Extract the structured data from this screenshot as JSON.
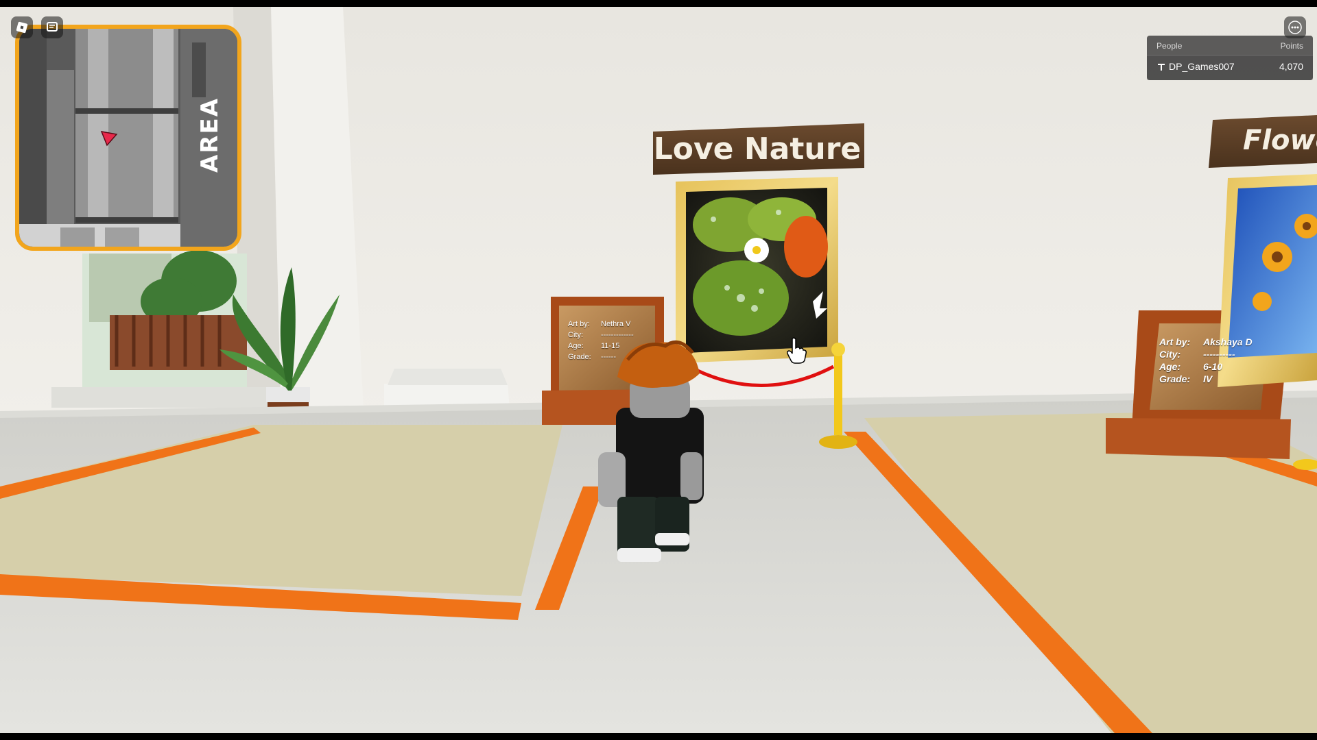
{
  "signs": {
    "left_title": "Love Nature",
    "right_title": "Flowe"
  },
  "plaque_left": {
    "art_by_label": "Art by:",
    "art_by_value": "Nethra V",
    "city_label": "City:",
    "city_value": "-------------",
    "age_label": "Age:",
    "age_value": "11-15",
    "grade_label": "Grade:",
    "grade_value": "------"
  },
  "plaque_right": {
    "art_by_label": "Art by:",
    "art_by_value": "Akshaya D",
    "city_label": "City:",
    "city_value": "----------",
    "age_label": "Age:",
    "age_value": "6-10",
    "grade_label": "Grade:",
    "grade_value": "IV"
  },
  "minimap": {
    "area_label": "AREA"
  },
  "leaderboard": {
    "header_people": "People",
    "header_points": "Points",
    "rows": [
      {
        "name": "DP_Games007",
        "points": "4,070"
      }
    ]
  },
  "icons": {
    "roblox_menu": "roblox-logo-icon",
    "chat": "chat-icon",
    "more": "more-icon",
    "player": "player-marker-icon",
    "cursor": "hand-cursor-icon"
  },
  "colors": {
    "accent_orange": "#f07318",
    "minimap_border": "#f2a51c",
    "rope_red": "#e01010",
    "stanchion_gold": "#f2c81c"
  }
}
